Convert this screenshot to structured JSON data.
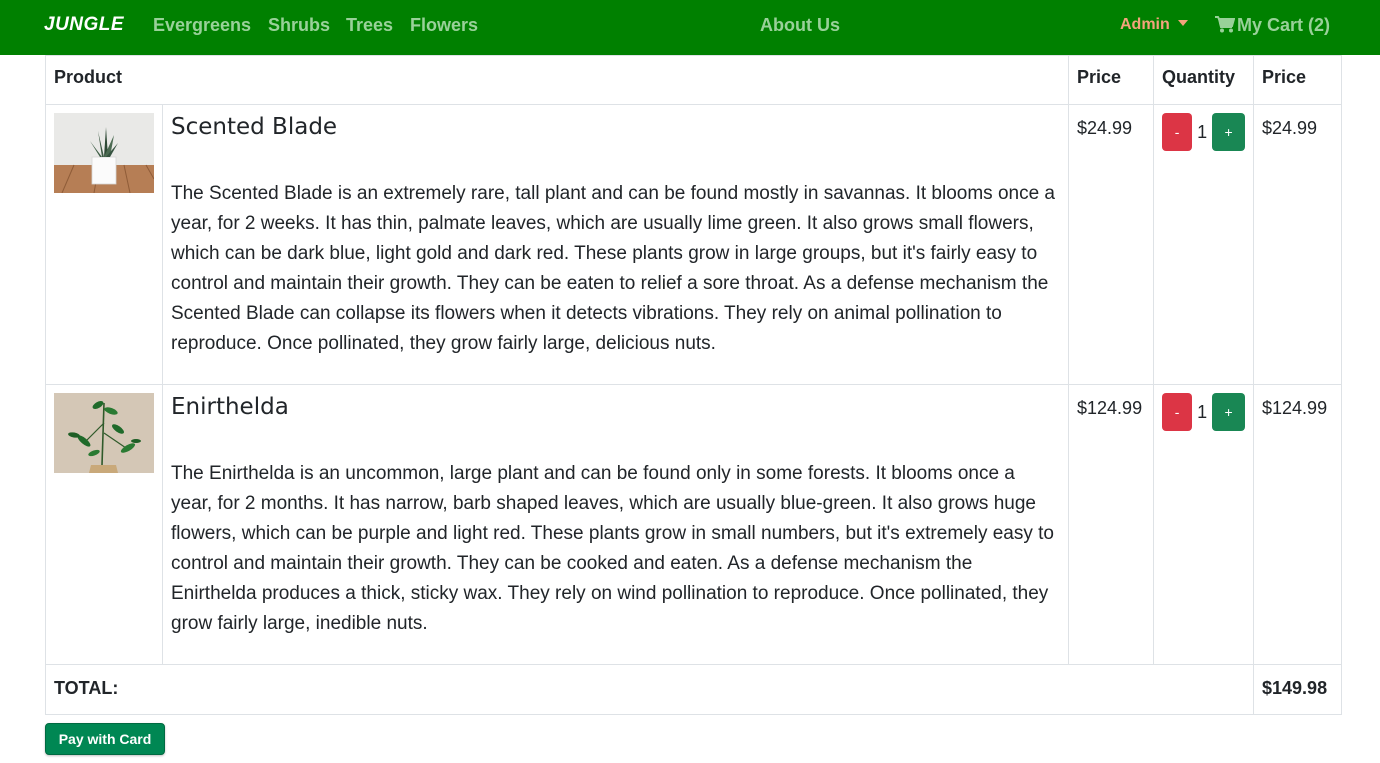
{
  "nav": {
    "brand": "JUNGLE",
    "links": [
      "Evergreens",
      "Shrubs",
      "Trees",
      "Flowers"
    ],
    "about": "About Us",
    "admin": "Admin",
    "cart": "My Cart (2)"
  },
  "table": {
    "headers": [
      "Product",
      "Price",
      "Quantity",
      "Price"
    ],
    "items": [
      {
        "name": "Scented Blade",
        "description": "The Scented Blade is an extremely rare, tall plant and can be found mostly in savannas. It blooms once a year, for 2 weeks. It has thin, palmate leaves, which are usually lime green. It also grows small flowers, which can be dark blue, light gold and dark red. These plants grow in large groups, but it's fairly easy to control and maintain their growth. They can be eaten to relief a sore throat. As a defense mechanism the Scented Blade can collapse its flowers when it detects vibrations. They rely on animal pollination to reproduce. Once pollinated, they grow fairly large, delicious nuts.",
        "price": "$24.99",
        "quantity": "1",
        "line_total": "$24.99"
      },
      {
        "name": "Enirthelda",
        "description": "The Enirthelda is an uncommon, large plant and can be found only in some forests. It blooms once a year, for 2 months. It has narrow, barb shaped leaves, which are usually blue-green. It also grows huge flowers, which can be purple and light red. These plants grow in small numbers, but it's extremely easy to control and maintain their growth. They can be cooked and eaten. As a defense mechanism the Enirthelda produces a thick, sticky wax. They rely on wind pollination to reproduce. Once pollinated, they grow fairly large, inedible nuts.",
        "price": "$124.99",
        "quantity": "1",
        "line_total": "$124.99"
      }
    ],
    "minus": "-",
    "plus": "+",
    "total_label": "TOTAL:",
    "total_value": "$149.98"
  },
  "pay_button": "Pay with Card",
  "colors": {
    "navbar": "#008000",
    "nav_link": "#99d199",
    "admin": "#f4a37c",
    "minus_button": "#dc3545",
    "plus_button": "#198754",
    "pay_button": "#008753"
  }
}
